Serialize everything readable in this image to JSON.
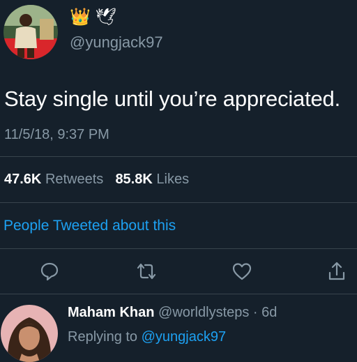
{
  "author": {
    "emojis": [
      "👑",
      "🕊"
    ],
    "handle": "@yungjack97"
  },
  "tweet": {
    "text": "Stay single until you’re appreciated.",
    "timestamp": "11/5/18, 9:37 PM"
  },
  "stats": {
    "retweets_count": "47.6K",
    "retweets_label": "Retweets",
    "likes_count": "85.8K",
    "likes_label": "Likes"
  },
  "people_tweeted_link": "People Tweeted about this",
  "actions": [
    "reply-icon",
    "retweet-icon",
    "like-icon",
    "share-icon"
  ],
  "reply": {
    "name": "Maham Khan",
    "handle": "@worldlysteps",
    "separator": " · ",
    "age": "6d",
    "replying_prefix": "Replying to ",
    "replying_to": "@yungjack97"
  },
  "colors": {
    "background": "#15202b",
    "accent": "#1da1f2",
    "secondary_text": "#8899a6",
    "divider": "#38444d"
  }
}
